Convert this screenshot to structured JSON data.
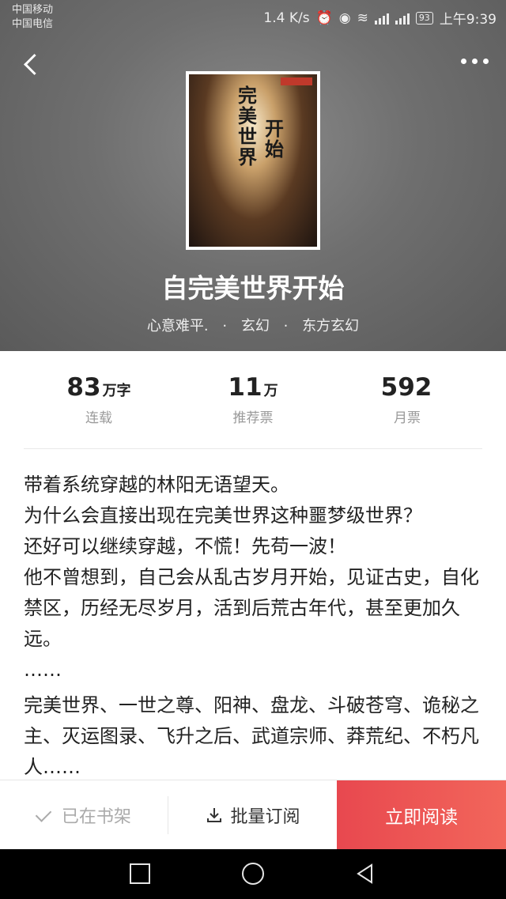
{
  "status_bar": {
    "carrier1": "中国移动",
    "carrier2": "中国电信",
    "speed": "1.4 K/s",
    "net1": "2G",
    "net2": "4G",
    "battery": "93",
    "time": "上午9:39"
  },
  "book": {
    "title": "自完美世界开始",
    "author": "心意难平.",
    "category": "玄幻",
    "subcategory": "东方玄幻",
    "separator": "·",
    "cover_text_1": "完美世界",
    "cover_text_2": "开始"
  },
  "stats": [
    {
      "num": "83",
      "unit": "万字",
      "label": "连载"
    },
    {
      "num": "11",
      "unit": "万",
      "label": "推荐票"
    },
    {
      "num": "592",
      "unit": "",
      "label": "月票"
    }
  ],
  "intro": {
    "line1": "带着系统穿越的林阳无语望天。",
    "line2": "为什么会直接出现在完美世界这种噩梦级世界？",
    "line3": "还好可以继续穿越，不慌！先苟一波！",
    "line4": "他不曾想到，自己会从乱古岁月开始，见证古史，自化禁区，历经无尽岁月，活到后荒古年代，甚至更加久远。",
    "line5": "……",
    "tags": "完美世界、一世之尊、阳神、盘龙、斗破苍穹、诡秘之主、灭运图录、飞升之后、武道宗师、莽荒纪、不朽凡人……"
  },
  "actions": {
    "bookshelf": "已在书架",
    "batch_subscribe": "批量订阅",
    "read_now": "立即阅读"
  },
  "colors": {
    "accent": "#ec5350",
    "hero_bg": "#6f6f6f"
  }
}
